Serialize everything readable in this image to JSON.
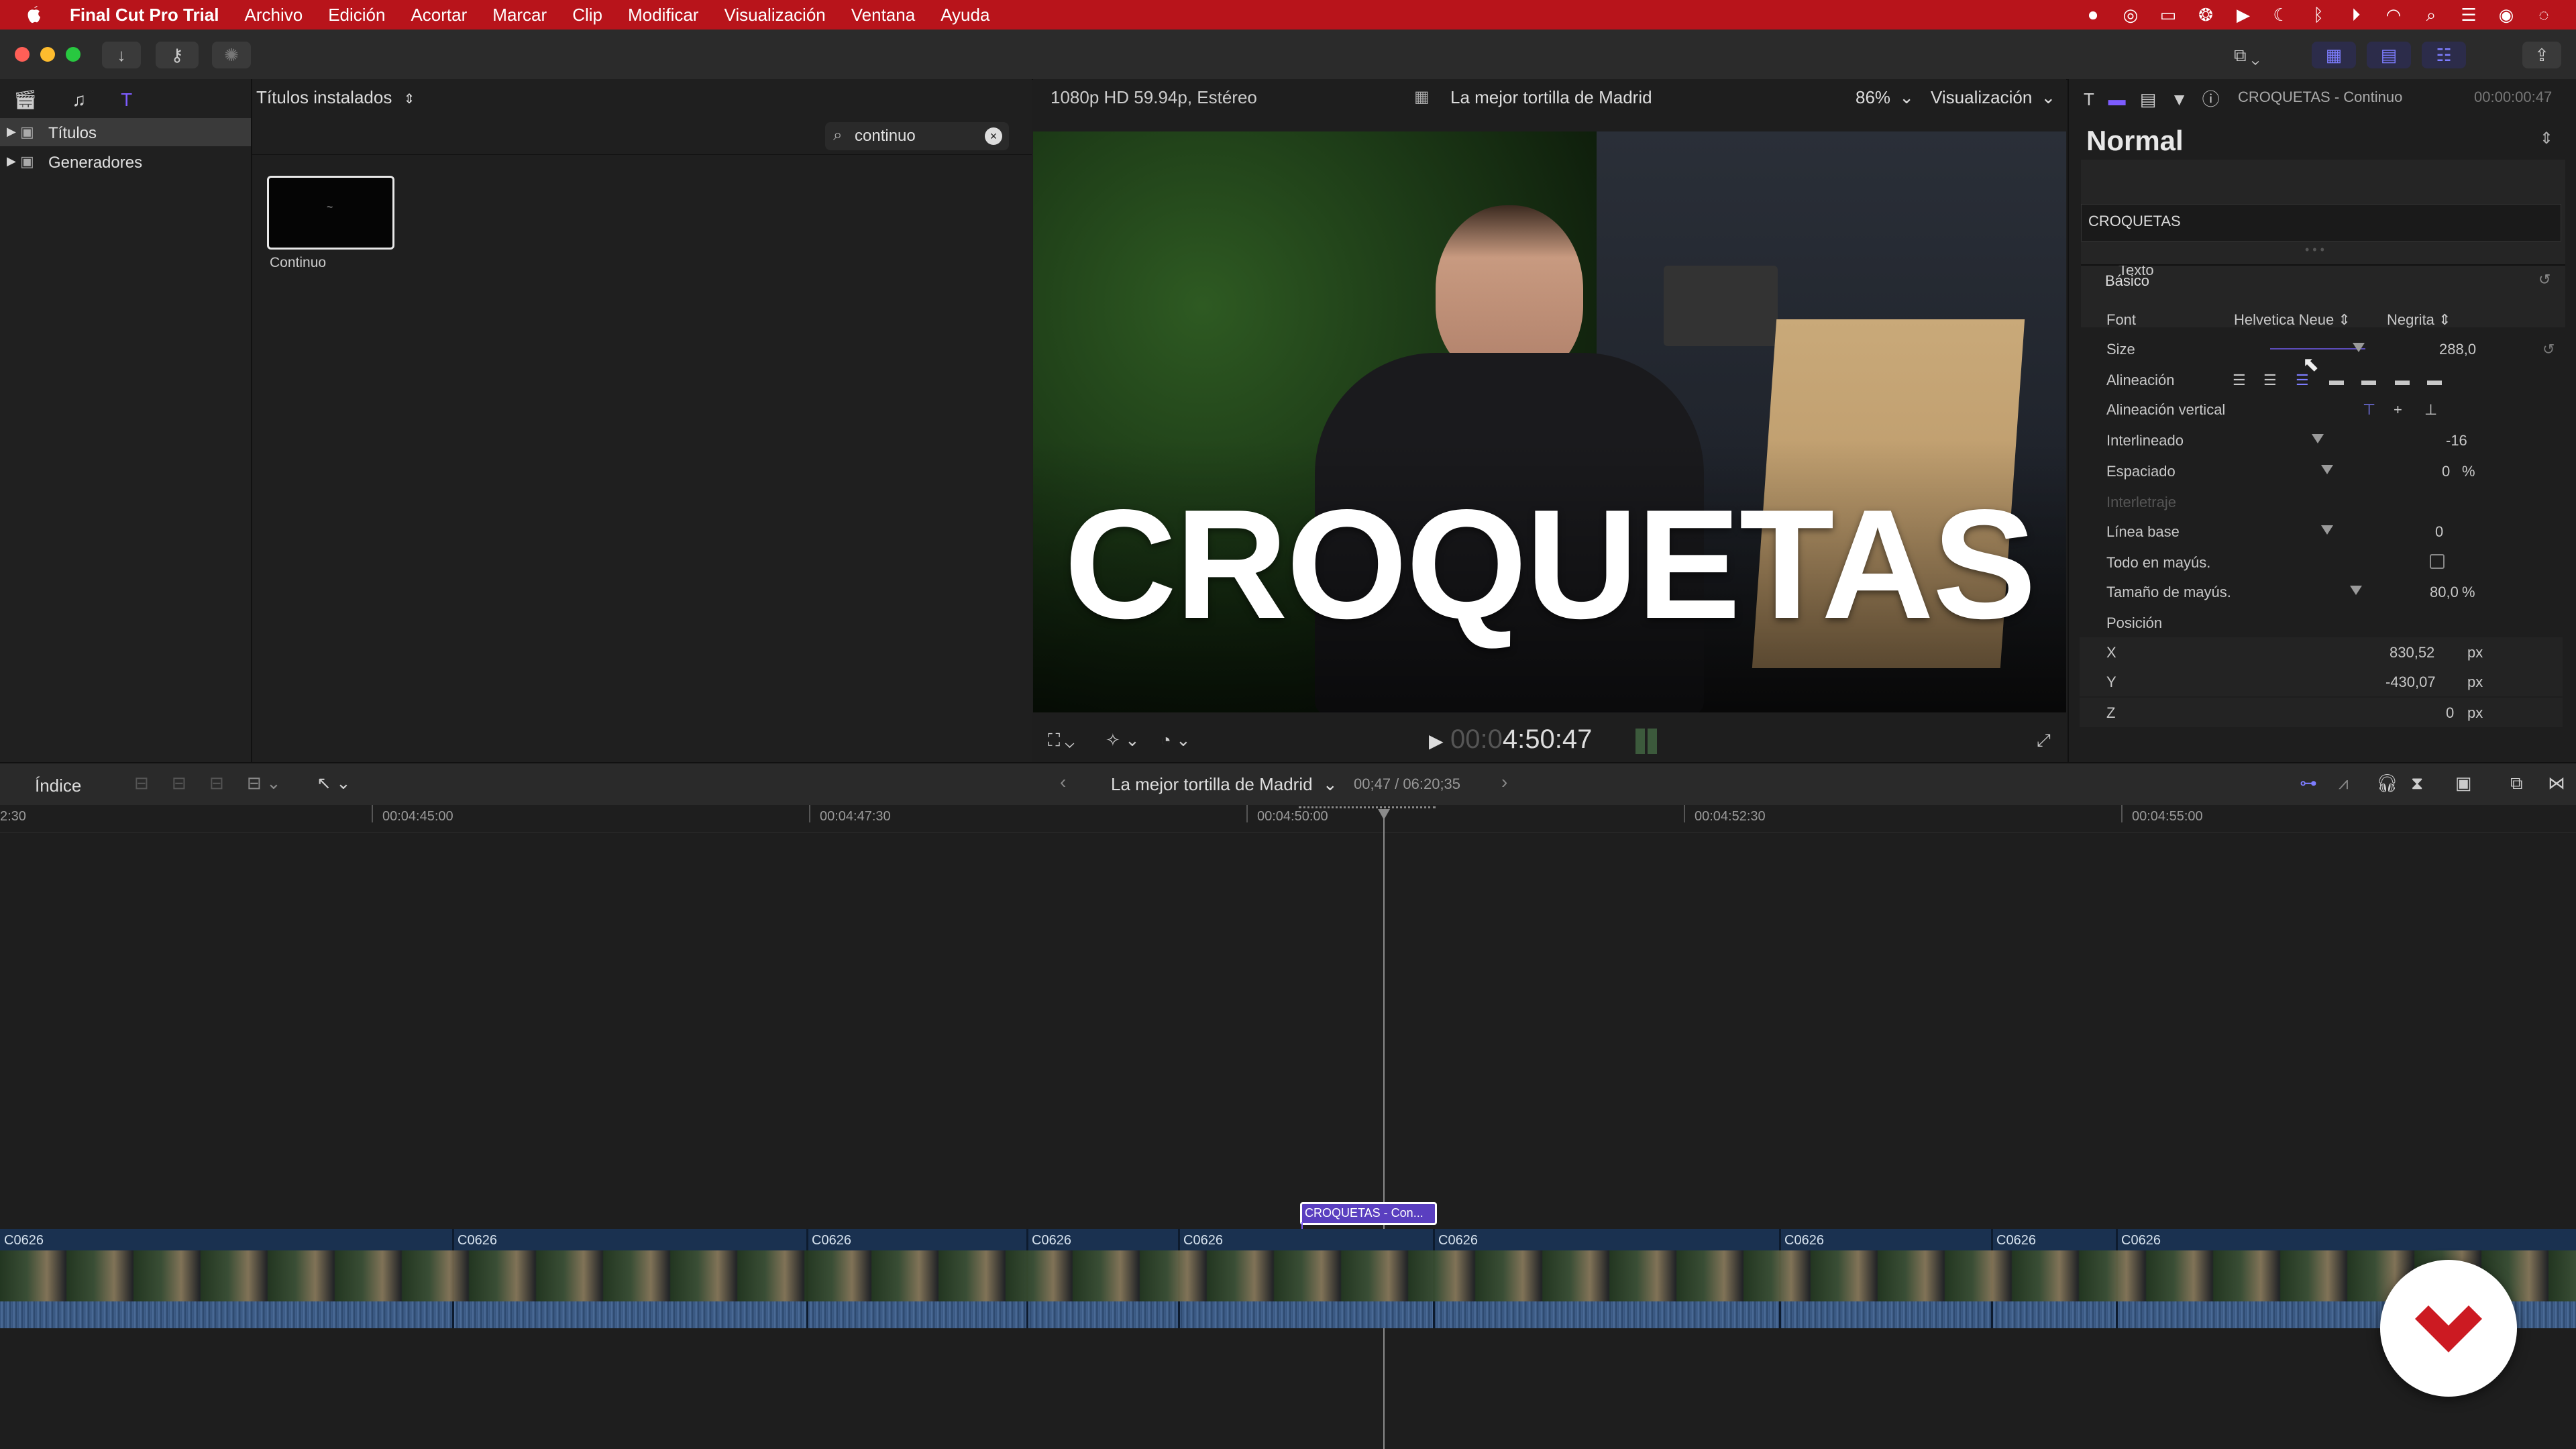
{
  "menubar": {
    "app": "Final Cut Pro Trial",
    "items": [
      "Archivo",
      "Edición",
      "Acortar",
      "Marcar",
      "Clip",
      "Modificar",
      "Visualización",
      "Ventana",
      "Ayuda"
    ]
  },
  "browser": {
    "library_header": "Títulos instalados",
    "sidebar_items": [
      "Títulos",
      "Generadores"
    ],
    "search_value": "continuo",
    "result_name": "Continuo"
  },
  "viewer": {
    "format": "1080p HD 59.94p, Estéreo",
    "project_name": "La mejor tortilla de Madrid",
    "zoom": "86%",
    "view_menu": "Visualización",
    "overlay_text": "CROQUETAS",
    "timecode_dim": "00:0",
    "timecode": "4:50:47"
  },
  "inspector": {
    "header_title": "CROQUETAS - Continuo",
    "header_time": "00:00:00:47",
    "preset": "Normal",
    "text_label": "Texto",
    "text_value": "CROQUETAS",
    "section_basic": "Básico",
    "rows": {
      "font": {
        "label": "Font",
        "family": "Helvetica Neue",
        "weight": "Negrita"
      },
      "size": {
        "label": "Size",
        "value": "288,0",
        "fraction": 0.93
      },
      "alignment": {
        "label": "Alineación"
      },
      "valign": {
        "label": "Alineación vertical"
      },
      "leading": {
        "label": "Interlineado",
        "value": "-16",
        "fraction": 0.5
      },
      "tracking": {
        "label": "Espaciado",
        "value": "0",
        "unit": "%",
        "fraction": 0.5
      },
      "kerning": {
        "label": "Interletraje"
      },
      "baseline": {
        "label": "Línea base",
        "value": "0",
        "fraction": 0.5
      },
      "allcaps": {
        "label": "Todo en mayús."
      },
      "capsize": {
        "label": "Tamaño de mayús.",
        "value": "80,0",
        "unit": "%",
        "fraction": 0.8
      },
      "position": {
        "label": "Posición"
      },
      "x": {
        "label": "X",
        "value": "830,52",
        "unit": "px"
      },
      "y": {
        "label": "Y",
        "value": "-430,07",
        "unit": "px"
      },
      "z": {
        "label": "Z",
        "value": "0",
        "unit": "px"
      }
    }
  },
  "timeline": {
    "index_button": "Índice",
    "project_name": "La mejor tortilla de Madrid",
    "position": "00;47 / 06:20;35",
    "ruler": [
      "2:30",
      "00:04:45:00",
      "00:04:47:30",
      "00:04:50:00",
      "00:04:52:30",
      "00:04:55:00"
    ],
    "title_clip": "CROQUETAS - Con...",
    "clip_name": "C0626"
  },
  "colors": {
    "menubar": "#b8141b",
    "accent": "#7d5cff",
    "title_clip": "#5a3fc0",
    "logo": "#cc1a22"
  }
}
